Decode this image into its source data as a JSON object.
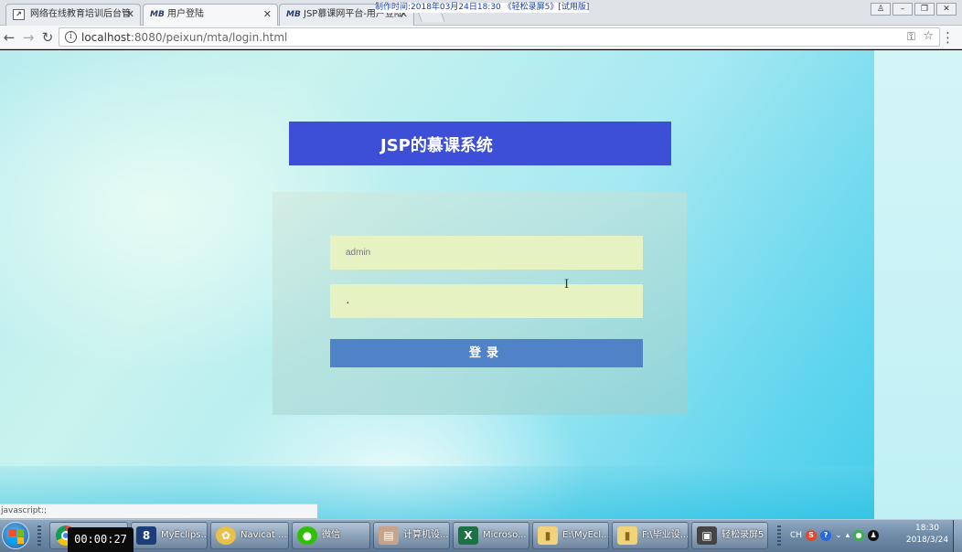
{
  "browser": {
    "tabs": [
      {
        "label": "网络在线教育培训后台管",
        "active": false
      },
      {
        "label": "用户登陆",
        "active": true
      },
      {
        "label": "JSP慕课网平台-用户登陆",
        "active": false
      }
    ],
    "url_host": "localhost",
    "url_rest": ":8080/peixun/mta/login.html",
    "status_url": "javascript:;"
  },
  "recorder": {
    "caption": "制作时间:2018年03月24日18:30 《轻松录屏5》[试用版]",
    "elapsed": "00:00:27"
  },
  "page": {
    "header_title": "JSP的慕课系统",
    "username_value": "admin",
    "password_value": "·",
    "login_label": "登录"
  },
  "taskbar": {
    "apps": [
      {
        "label": "MyEclips...",
        "icon": "myeclipse-icon"
      },
      {
        "label": "Navicat ...",
        "icon": "navicat-icon"
      },
      {
        "label": "微信",
        "icon": "wechat-icon"
      },
      {
        "label": "计算机设...",
        "icon": "document-icon"
      },
      {
        "label": "Microso...",
        "icon": "excel-icon"
      },
      {
        "label": "E:\\MyEcl...",
        "icon": "folder-icon"
      },
      {
        "label": "F:\\毕业设...",
        "icon": "folder-icon"
      },
      {
        "label": "轻松录屏5",
        "icon": "screen-recorder-icon"
      }
    ],
    "tray_lang": "CH",
    "clock_time": "18:30",
    "clock_date": "2018/3/24"
  },
  "colors": {
    "header_bar": "#3d4fd6",
    "login_button": "#5082c8",
    "input_bg": "#e6f2c2"
  }
}
